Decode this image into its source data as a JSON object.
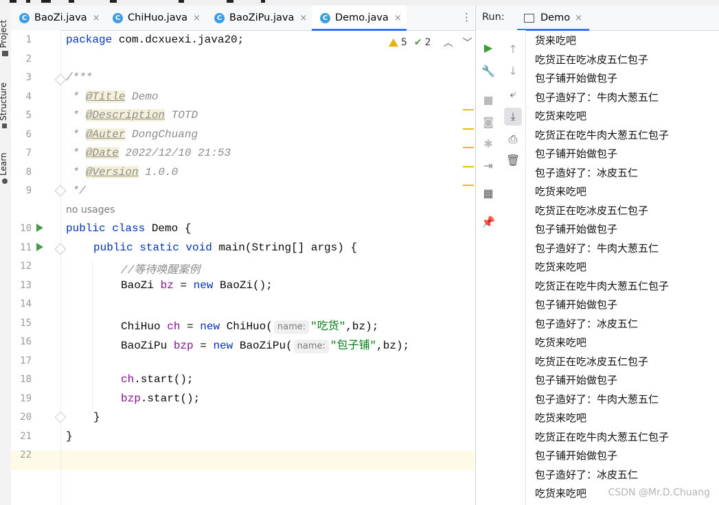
{
  "tabs": [
    {
      "label": "BaoZi.java",
      "icon": "class-icon"
    },
    {
      "label": "ChiHuo.java",
      "icon": "class-icon"
    },
    {
      "label": "BaoZiPu.java",
      "icon": "class-icon"
    },
    {
      "label": "Demo.java",
      "icon": "class-run-icon",
      "active": true
    }
  ],
  "close_glyph": "×",
  "left_strip": {
    "project": "Project",
    "structure": "Structure",
    "learn": "Learn"
  },
  "inspections": {
    "warnings": "5",
    "checks": "2"
  },
  "line_numbers": [
    "1",
    "2",
    "3",
    "4",
    "5",
    "6",
    "7",
    "8",
    "9",
    "10",
    "11",
    "12",
    "13",
    "14",
    "15",
    "16",
    "17",
    "18",
    "19",
    "20",
    "21",
    "22"
  ],
  "code": {
    "l1_kw": "package",
    "l1_rest": " com.dcxuexi.java20;",
    "l3": "/***",
    "l4_tag": "@Title",
    "l4_val": " Demo",
    "l5_tag": "@Description",
    "l5_val": " TOTD",
    "l6_tag": "@Auter",
    "l6_val": " DongChuang",
    "l7_tag": "@Date",
    "l7_val": " 2022/12/10 21:53",
    "l8_tag": "@Version",
    "l8_val": " 1.0.0",
    "l9": " */",
    "usages": "no usages",
    "l10_kw": "public class",
    "l10_rest": " Demo {",
    "l11_kw": "public static void",
    "l11_rest": " main(String[] args) {",
    "l12": "//等待唤醒案例",
    "l13_a": "BaoZi ",
    "l13_var": "bz",
    "l13_b": " = ",
    "l13_kw": "new",
    "l13_c": " BaoZi();",
    "l15_a": "ChiHuo ",
    "l15_var": "ch",
    "l15_b": " = ",
    "l15_kw": "new",
    "l15_c": " ChiHuo(",
    "l15_hint": "name:",
    "l15_str": "\"吃货\"",
    "l15_d": ",bz);",
    "l16_a": "BaoZiPu ",
    "l16_var": "bzp",
    "l16_b": " = ",
    "l16_kw": "new",
    "l16_c": " BaoZiPu(",
    "l16_hint": "name:",
    "l16_str": "\"包子铺\"",
    "l16_d": ",bz);",
    "l18_var": "ch",
    "l18_rest": ".start();",
    "l19_var": "bzp",
    "l19_rest": ".start();",
    "l20": "}",
    "l21": "}"
  },
  "run": {
    "label": "Run:",
    "tab": "Demo",
    "output": [
      "货来吃吧",
      "吃货正在吃冰皮五仁包子",
      "包子铺开始做包子",
      "包子造好了：牛肉大葱五仁",
      "吃货来吃吧",
      "吃货正在吃牛肉大葱五仁包子",
      "包子铺开始做包子",
      "包子造好了：冰皮五仁",
      "吃货来吃吧",
      "吃货正在吃冰皮五仁包子",
      "包子铺开始做包子",
      "包子造好了：牛肉大葱五仁",
      "吃货来吃吧",
      "吃货正在吃牛肉大葱五仁包子",
      "包子铺开始做包子",
      "包子造好了：冰皮五仁",
      "吃货来吃吧",
      "吃货正在吃冰皮五仁包子",
      "包子铺开始做包子",
      "包子造好了：牛肉大葱五仁",
      "吃货来吃吧",
      "吃货正在吃牛肉大葱五仁包子",
      "包子铺开始做包子",
      "包子造好了：冰皮五仁",
      "吃货来吃吧"
    ]
  },
  "watermark": "CSDN @Mr.D.Chuang",
  "colors": {
    "keyword": "#0033b3",
    "field": "#871094",
    "string": "#067d17",
    "comment": "#8c8c8c",
    "accent": "#3574f0",
    "run_green": "#4a9a4a"
  }
}
